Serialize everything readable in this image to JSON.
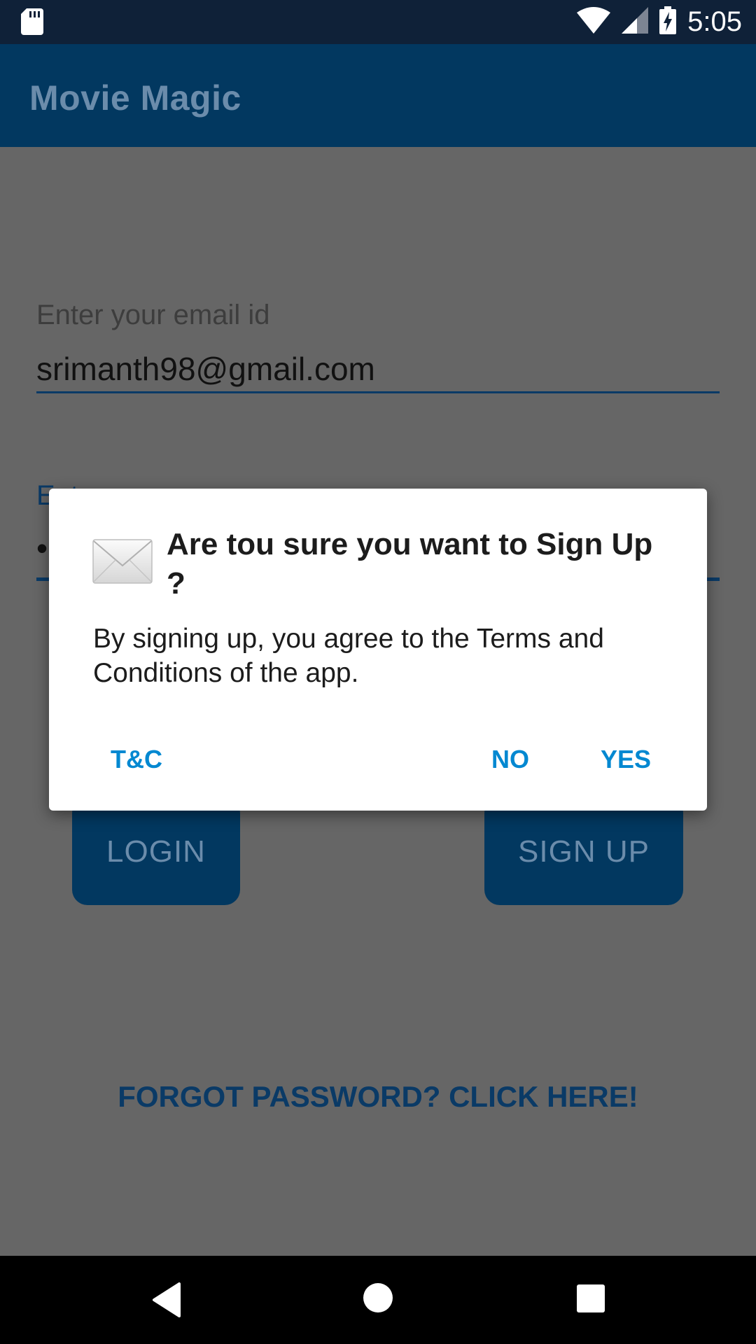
{
  "status_bar": {
    "time": "5:05",
    "icons": [
      "sd-card-icon",
      "wifi-icon",
      "signal-icon",
      "battery-charging-icon"
    ]
  },
  "app_bar": {
    "title": "Movie Magic"
  },
  "form": {
    "email_label": "Enter your email id",
    "email_value": "srimanth98@gmail.com",
    "password_label": "Ent",
    "password_value": "•"
  },
  "buttons": {
    "login": "LOGIN",
    "signup": "SIGN UP",
    "forgot": "FORGOT PASSWORD? CLICK HERE!"
  },
  "dialog": {
    "icon": "envelope-icon",
    "title": "Are tou sure you want to Sign Up ?",
    "message": "By signing up, you agree to the Terms and Conditions of the app.",
    "actions": {
      "tc": "T&C",
      "no": "NO",
      "yes": "YES"
    }
  },
  "colors": {
    "primary_dark": "#023860",
    "status_bar": "#0f2138",
    "accent": "#0388d1",
    "scrim_background": "#666666"
  },
  "nav_bar": {
    "icons": [
      "back-icon",
      "home-icon",
      "recents-icon"
    ]
  }
}
